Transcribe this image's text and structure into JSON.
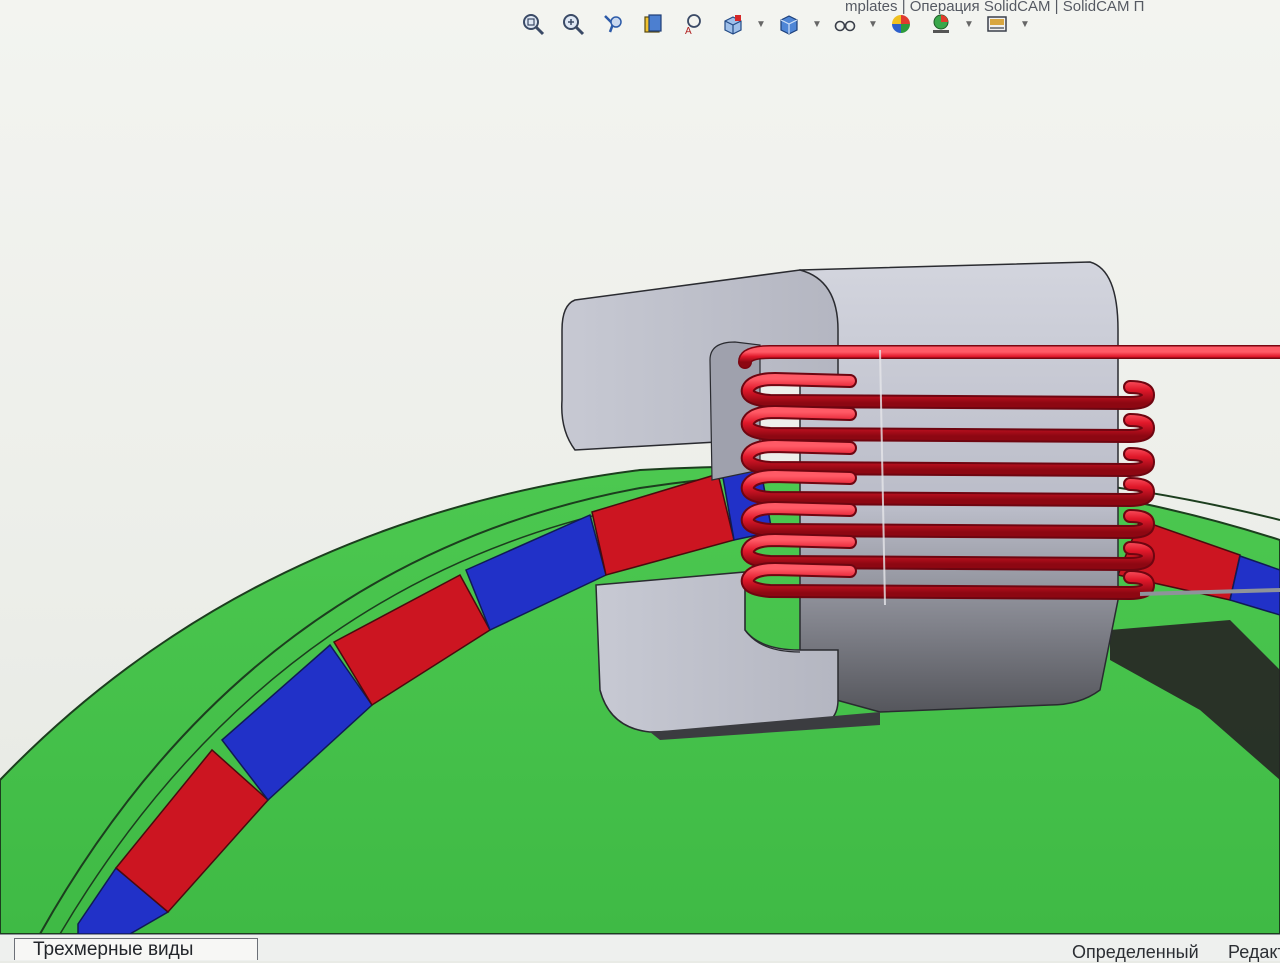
{
  "window": {
    "title": "mplates | Операция SolidCAM | SolidCAM П"
  },
  "toolbar": {
    "buttons": [
      {
        "icon": "zoom-to-fit-icon"
      },
      {
        "icon": "zoom-to-area-icon"
      },
      {
        "icon": "previous-view-icon"
      },
      {
        "icon": "section-view-icon"
      },
      {
        "icon": "dynamic-annotation-icon"
      },
      {
        "icon": "view-orientation-icon",
        "dropdown": true
      },
      {
        "icon": "display-style-icon",
        "dropdown": true
      },
      {
        "icon": "hide-show-items-icon",
        "dropdown": true
      },
      {
        "icon": "edit-appearance-icon"
      },
      {
        "icon": "apply-scene-icon",
        "dropdown": true
      },
      {
        "icon": "view-settings-icon",
        "dropdown": true
      }
    ]
  },
  "colors": {
    "background": "#eceee9",
    "green_body": "#46c34c",
    "magnet_red": "#cc1521",
    "magnet_blue": "#2131c8",
    "core_gray": "#b9bbc6",
    "coil_red": "#e0182a"
  },
  "tabs": {
    "three_d_views": "Трехмерные виды"
  },
  "status": {
    "left": "Определенный",
    "right": "Редакт"
  }
}
